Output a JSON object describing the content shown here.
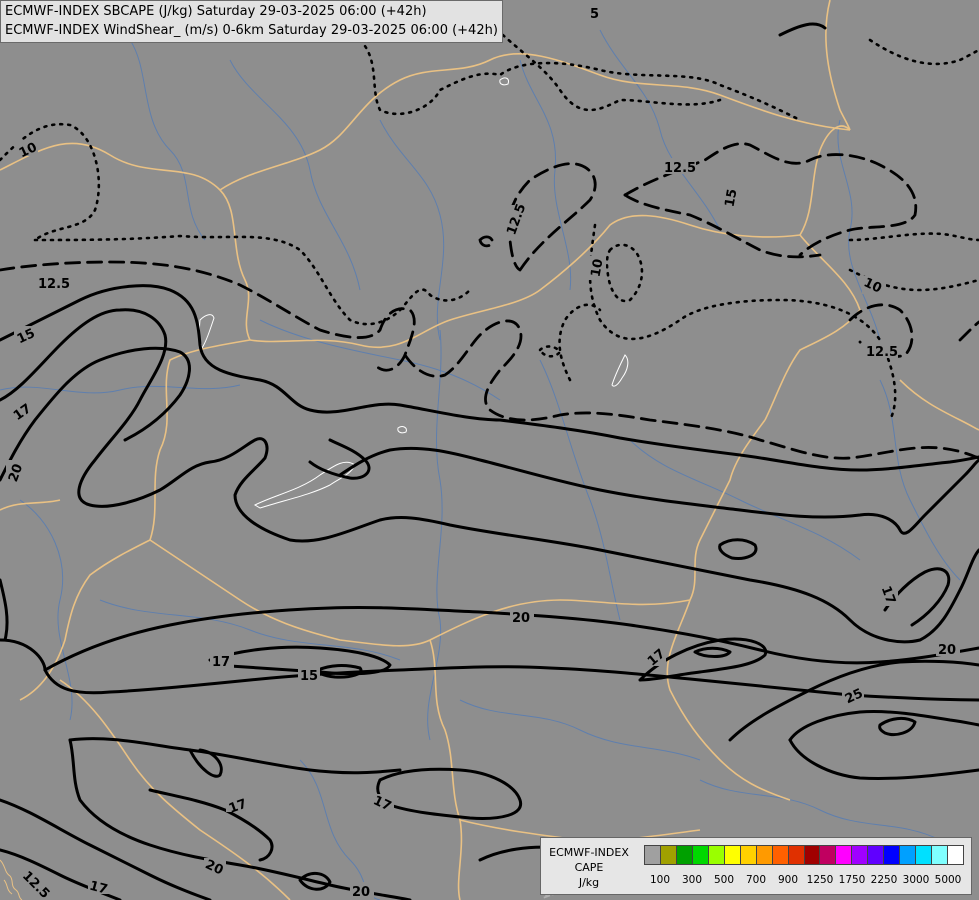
{
  "header": {
    "line1": "ECMWF-INDEX SBCAPE (J/kg) Saturday 29-03-2025 06:00 (+42h)",
    "line2": "ECMWF-INDEX WindShear_ (m/s) 0-6km Saturday 29-03-2025 06:00 (+42h)"
  },
  "contour_labels": [
    {
      "text": "5",
      "kind": "dotted"
    },
    {
      "text": "10",
      "kind": "dotted"
    },
    {
      "text": "12.5",
      "kind": "dashed"
    },
    {
      "text": "12.5",
      "kind": "dashed"
    },
    {
      "text": "12.5",
      "kind": "dashed"
    },
    {
      "text": "15",
      "kind": "solid"
    },
    {
      "text": "10",
      "kind": "dotted"
    },
    {
      "text": "10",
      "kind": "dotted"
    },
    {
      "text": "12.5",
      "kind": "dashed"
    },
    {
      "text": "15",
      "kind": "solid"
    },
    {
      "text": "17",
      "kind": "solid"
    },
    {
      "text": "20",
      "kind": "solid"
    },
    {
      "text": "17",
      "kind": "solid"
    },
    {
      "text": "20",
      "kind": "solid"
    },
    {
      "text": "17",
      "kind": "solid"
    },
    {
      "text": "15",
      "kind": "solid"
    },
    {
      "text": "17",
      "kind": "solid"
    },
    {
      "text": "20",
      "kind": "solid"
    },
    {
      "text": "25",
      "kind": "solid"
    },
    {
      "text": "17",
      "kind": "solid"
    },
    {
      "text": "17",
      "kind": "solid"
    },
    {
      "text": "20",
      "kind": "solid"
    },
    {
      "text": "17",
      "kind": "solid"
    },
    {
      "text": "20",
      "kind": "solid"
    },
    {
      "text": "12.5",
      "kind": "dashed"
    },
    {
      "text": "15",
      "kind": "solid"
    }
  ],
  "legend": {
    "model": "ECMWF-INDEX",
    "variable": "CAPE",
    "unit": "J/kg",
    "colors": [
      "#a0a0a0",
      "#a0a000",
      "#00a000",
      "#00d800",
      "#9aff00",
      "#ffff00",
      "#ffd000",
      "#ff9a00",
      "#ff6000",
      "#e03000",
      "#a00000",
      "#c00060",
      "#ff00ff",
      "#a000ff",
      "#6000ff",
      "#0000ff",
      "#00a0ff",
      "#00e0ff",
      "#80ffff",
      "#ffffff"
    ],
    "ticks": [
      "100",
      "300",
      "500",
      "700",
      "900",
      "1250",
      "1750",
      "2250",
      "3000",
      "5000"
    ]
  }
}
